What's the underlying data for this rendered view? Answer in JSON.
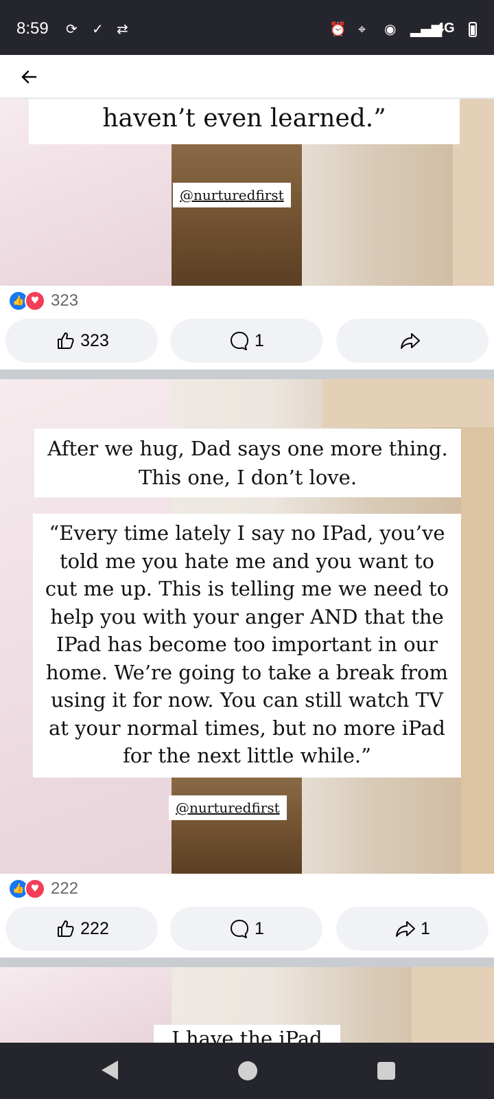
{
  "status_bar": {
    "time": "8:59",
    "network": "4G",
    "icons": [
      "sync-icon",
      "download-done-icon",
      "transfer-icon",
      "alarm-icon",
      "location-icon",
      "hotspot-icon",
      "signal-icon",
      "battery-icon"
    ]
  },
  "top_bar": {
    "back_icon": "arrow-left-icon"
  },
  "posts": [
    {
      "text_top": "haven’t even learned.”",
      "tag": "@nurturedfirst",
      "reaction_count": "323",
      "like_count": "323",
      "comment_count": "1",
      "share_count": ""
    },
    {
      "text_intro": "After we hug, Dad says one more thing. This one, I don’t love.",
      "quote_lines": [
        "“Every time lately I say no IPad, you’ve",
        "told me you hate me and you want to",
        "cut me up. This is telling me we need to",
        "help you with your anger AND that the",
        "IPad has become too important in our",
        "home. We’re going to take a break from",
        "using it for now. You can still watch TV",
        "at your normal times, but no more iPad",
        "for the next little while.”"
      ],
      "tag": "@nurturedfirst",
      "reaction_count": "222",
      "like_count": "222",
      "comment_count": "1",
      "share_count": "1"
    },
    {
      "text_partial": "I have the iPad"
    }
  ],
  "colors": {
    "status_bg": "#25252d",
    "like_blue": "#1877f2",
    "love_red": "#f33e58",
    "button_bg": "#f0f2f5"
  }
}
